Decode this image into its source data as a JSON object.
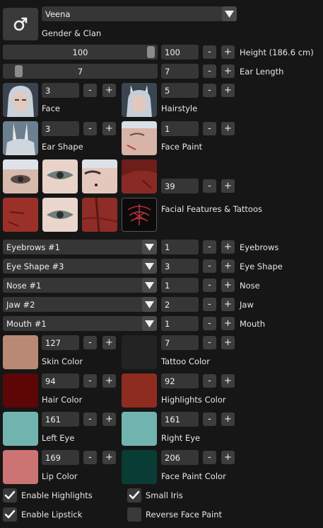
{
  "header": {
    "gender_icon": "male-icon",
    "race_selected": "Veena",
    "gender_clan_label": "Gender & Clan"
  },
  "height": {
    "slider_value": "100",
    "value": "100",
    "label": "Height (186.6 cm)",
    "level_percent": 100
  },
  "ear_length": {
    "slider_value": "7",
    "value": "7",
    "label": "Ear Length",
    "level_percent": 7
  },
  "face": {
    "value": "3",
    "label": "Face"
  },
  "hairstyle": {
    "value": "5",
    "label": "Hairstyle"
  },
  "ear_shape": {
    "value": "3",
    "label": "Ear Shape"
  },
  "face_paint": {
    "value": "1",
    "label": "Face Paint"
  },
  "facial_features": {
    "value": "39",
    "label": "Facial Features & Tattoos"
  },
  "dropdowns": [
    {
      "selected": "Eyebrows #1",
      "value": "1",
      "label": "Eyebrows"
    },
    {
      "selected": "Eye Shape #3",
      "value": "3",
      "label": "Eye Shape"
    },
    {
      "selected": "Nose #1",
      "value": "1",
      "label": "Nose"
    },
    {
      "selected": "Jaw #2",
      "value": "2",
      "label": "Jaw"
    },
    {
      "selected": "Mouth #1",
      "value": "1",
      "label": "Mouth"
    }
  ],
  "colors": [
    {
      "value": "127",
      "label": "Skin Color",
      "color": "#b98976"
    },
    {
      "value": "7",
      "label": "Tattoo Color",
      "color": "#232323"
    },
    {
      "value": "94",
      "label": "Hair Color",
      "color": "#5c0606"
    },
    {
      "value": "92",
      "label": "Highlights Color",
      "color": "#8f2c20"
    },
    {
      "value": "161",
      "label": "Left Eye",
      "color": "#71b4af"
    },
    {
      "value": "161",
      "label": "Right Eye",
      "color": "#71b4af"
    },
    {
      "value": "169",
      "label": "Lip Color",
      "color": "#cc7373"
    },
    {
      "value": "206",
      "label": "Face Paint Color",
      "color": "#093c35"
    }
  ],
  "checkboxes": [
    {
      "label": "Enable Highlights",
      "checked": true
    },
    {
      "label": "Small Iris",
      "checked": true
    },
    {
      "label": "Enable Lipstick",
      "checked": true
    },
    {
      "label": "Reverse Face Paint",
      "checked": false
    }
  ],
  "controls": {
    "minus": "-",
    "plus": "+"
  }
}
